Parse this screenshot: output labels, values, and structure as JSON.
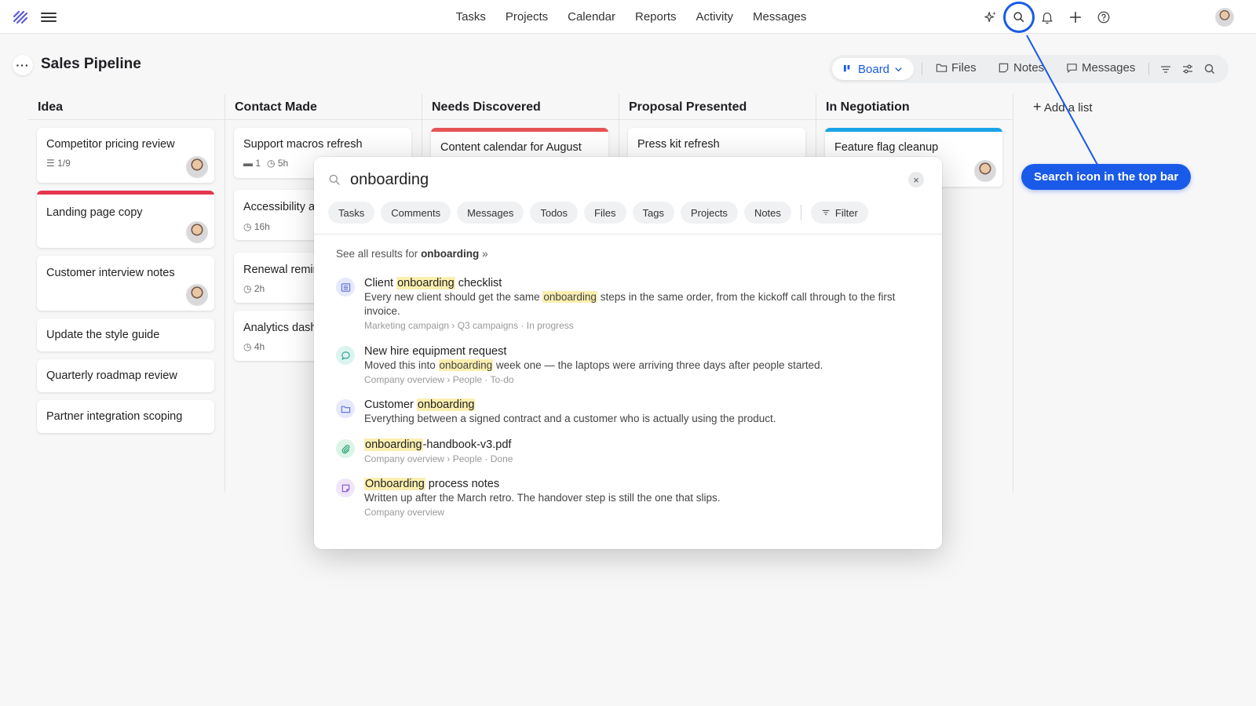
{
  "nav": {
    "items": [
      "Tasks",
      "Projects",
      "Calendar",
      "Reports",
      "Activity",
      "Messages"
    ]
  },
  "page": {
    "title": "Sales Pipeline",
    "more_label": "···"
  },
  "viewbar": {
    "board_label": "Board",
    "files_label": "Files",
    "notes_label": "Notes",
    "messages_label": "Messages"
  },
  "columns": [
    {
      "title": "Idea",
      "cards": [
        {
          "title": "Competitor pricing review",
          "meta": [
            "1/9"
          ],
          "avatar": true
        },
        {
          "title": "Landing page copy",
          "bar": "#e5364f",
          "avatar": true
        },
        {
          "title": "Customer interview notes",
          "avatar": true
        },
        {
          "title": "Update the style guide"
        },
        {
          "title": "Quarterly roadmap review"
        },
        {
          "title": "Partner integration scoping"
        }
      ]
    },
    {
      "title": "Contact Made",
      "cards": [
        {
          "title": "Support macros refresh",
          "meta": [
            "1",
            "5h"
          ]
        },
        {
          "title": "Accessibility a",
          "meta": [
            "16h"
          ]
        },
        {
          "title": "Renewal remir",
          "meta": [
            "2h"
          ]
        },
        {
          "title": "Analytics dash",
          "meta": [
            "4h"
          ]
        }
      ]
    },
    {
      "title": "Needs Discovered",
      "cards": [
        {
          "title": "Content calendar for August",
          "bar": "#e55454"
        }
      ]
    },
    {
      "title": "Proposal Presented",
      "cards": [
        {
          "title": "Press kit refresh"
        }
      ]
    },
    {
      "title": "In Negotiation",
      "cards": [
        {
          "title": "Feature flag cleanup",
          "bar": "#1aa4e8",
          "avatar": true
        }
      ]
    }
  ],
  "add_list_label": "Add a list",
  "search": {
    "query": "onboarding",
    "clear_label": "×",
    "chips": [
      "Tasks",
      "Comments",
      "Messages",
      "Todos",
      "Files",
      "Tags",
      "Projects",
      "Notes"
    ],
    "filter_label": "Filter",
    "see_all_prefix": "See all results for",
    "see_all_term": "onboarding",
    "see_all_suffix": "»",
    "results": [
      {
        "icon": "checklist-icon",
        "icon_color": "#5b6bd6",
        "icon_bg": "#e6e9fb",
        "title": [
          "Client ",
          "onboarding",
          " checklist"
        ],
        "desc": [
          "Every new client should get the same ",
          "onboarding",
          " steps in the same order, from the kickoff call through to the first invoice."
        ],
        "path": "Marketing campaign  ›  Q3 campaigns · In progress"
      },
      {
        "icon": "comment-icon",
        "icon_color": "#1a9e8f",
        "icon_bg": "#dcf4f0",
        "title": [
          "New hire equipment request",
          "",
          ""
        ],
        "desc": [
          "Moved this into ",
          "onboarding",
          " week one — the laptops were arriving three days after people started."
        ],
        "path": "Company overview  ›  People · To-do"
      },
      {
        "icon": "folder-icon",
        "icon_color": "#5b6bd6",
        "icon_bg": "#e6e9fb",
        "title": [
          "Customer ",
          "onboarding",
          ""
        ],
        "desc": [
          "Everything between a signed contract and a customer who is actually using the product.",
          "",
          ""
        ],
        "path": ""
      },
      {
        "icon": "paperclip-icon",
        "icon_color": "#1a9e6f",
        "icon_bg": "#dcf4e8",
        "title": [
          "",
          "onboarding",
          "-handbook-v3.pdf"
        ],
        "desc": [
          "",
          "",
          ""
        ],
        "path": "Company overview  ›  People · Done"
      },
      {
        "icon": "note-icon",
        "icon_color": "#8a4fd6",
        "icon_bg": "#efe6fb",
        "title": [
          "",
          "Onboarding",
          " process notes"
        ],
        "desc": [
          "Written up after the March retro. The handover step is still the one that slips.",
          "",
          ""
        ],
        "path": "Company overview"
      }
    ]
  },
  "callout": {
    "label": "Search icon in the top bar"
  }
}
